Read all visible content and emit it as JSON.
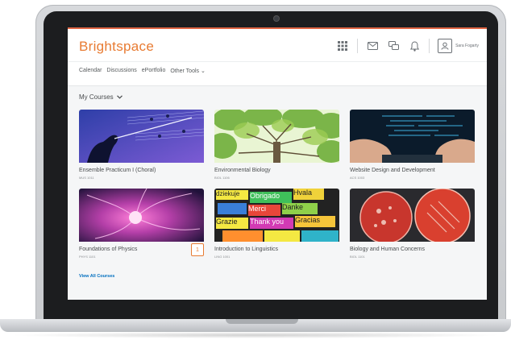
{
  "brand": {
    "name": "Brightspace",
    "color": "#e87b32"
  },
  "header": {
    "icons": [
      "grid-icon",
      "mail-icon",
      "chat-icon",
      "bell-icon"
    ],
    "user_name": "Sara Fogarty"
  },
  "menu": {
    "items": [
      "Calendar",
      "Discussions",
      "ePortfolio",
      "Other Tools"
    ]
  },
  "widget": {
    "title": "My Courses"
  },
  "courses": [
    {
      "title": "Ensemble Practicum I (Choral)",
      "code": "MUS 1011"
    },
    {
      "title": "Environmental Biology",
      "code": "BIOL 1106"
    },
    {
      "title": "Website Design and Development",
      "code": "ACS 1003"
    },
    {
      "title": "Foundations of Physics",
      "code": "PHYS 1101",
      "badge": "1"
    },
    {
      "title": "Introduction to Linguistics",
      "code": "LING 1001"
    },
    {
      "title": "Biology and Human Concerns",
      "code": "BIOL 1101"
    }
  ],
  "view_all_label": "View All Courses",
  "language_words": [
    "dziekuje",
    "Obrigado",
    "Hvala",
    "Merci",
    "Danke",
    "Grazie",
    "Thank you",
    "Gracias"
  ]
}
